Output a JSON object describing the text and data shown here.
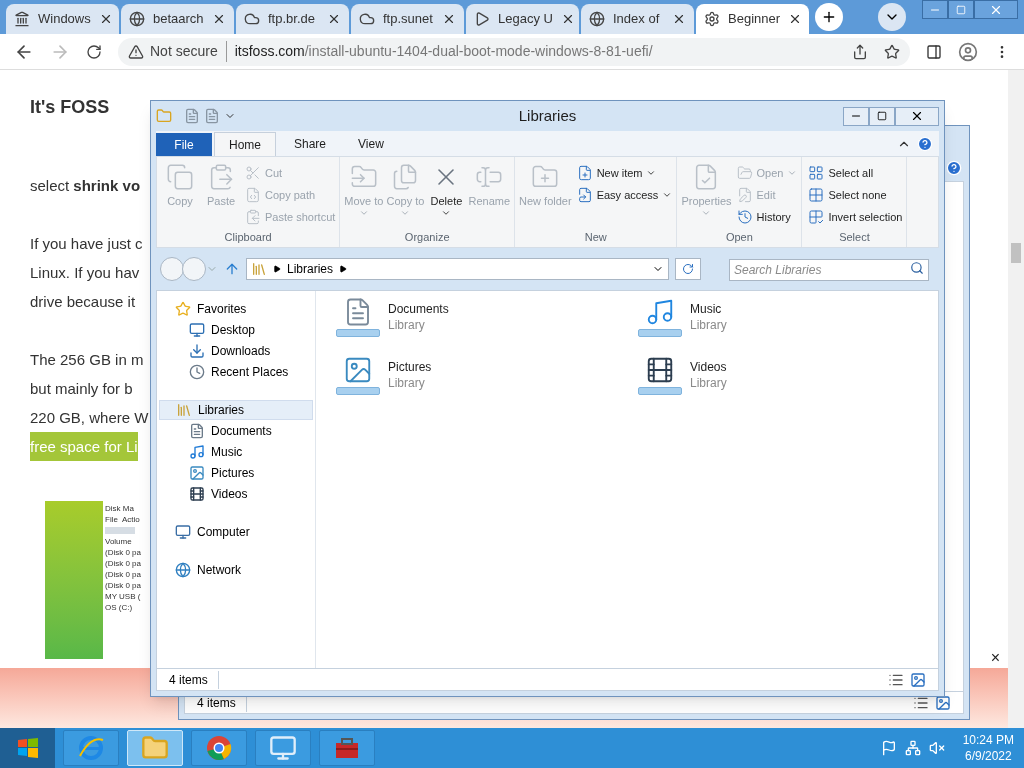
{
  "browser": {
    "tabs": [
      {
        "title": "Windows",
        "selected": false
      },
      {
        "title": "betaarch",
        "selected": false
      },
      {
        "title": "ftp.br.de",
        "selected": false
      },
      {
        "title": "ftp.sunet",
        "selected": false
      },
      {
        "title": "Legacy U",
        "selected": false
      },
      {
        "title": "Index of",
        "selected": false
      },
      {
        "title": "Beginner",
        "selected": true
      }
    ],
    "address": {
      "warning": "Not secure",
      "url": "itsfoss.com/install-ubuntu-1404-dual-boot-mode-windows-8-81-uefi/"
    }
  },
  "page": {
    "site_title": "It's FOSS",
    "paragraphs": [
      {
        "lines": [
          {
            "text": "select **shrink vo**",
            "highlighted": false
          }
        ]
      },
      {
        "lines": [
          {
            "text": "If you have just c",
            "highlighted": false
          },
          {
            "text": "Linux. If you hav",
            "highlighted": false
          },
          {
            "text": "drive because it",
            "highlighted": false
          }
        ]
      },
      {
        "lines": [
          {
            "text": "The 256 GB in m",
            "highlighted": false
          },
          {
            "text": "but mainly for b",
            "highlighted": false
          },
          {
            "text": "220 GB, where W",
            "highlighted": false
          },
          {
            "text": "free space for Li",
            "highlighted": true
          }
        ]
      }
    ],
    "embedded_screenshot": {
      "title": "Disk Ma",
      "menu": [
        "File",
        "Actio"
      ],
      "column": "Volume",
      "rows": [
        "(Disk 0 pa",
        "(Disk 0 pa",
        "(Disk 0 pa",
        "(Disk 0 pa",
        "MY USB (",
        "OS (C:)"
      ]
    },
    "ad": {
      "close": "×"
    }
  },
  "explorer": {
    "title": "Libraries",
    "ribbon_tabs": [
      {
        "label": "File",
        "kind": "file",
        "selected": false
      },
      {
        "label": "Home",
        "kind": "tab",
        "selected": true
      },
      {
        "label": "Share",
        "kind": "tab",
        "selected": false
      },
      {
        "label": "View",
        "kind": "tab",
        "selected": false
      }
    ],
    "groups": [
      {
        "label": "Clipboard",
        "items": [
          {
            "label": "Copy",
            "kind": "large",
            "disabled": true,
            "dropdown": false
          },
          {
            "label": "Paste",
            "kind": "large",
            "disabled": true,
            "dropdown": false
          },
          {
            "label": "Cut",
            "kind": "small",
            "disabled": true,
            "dropdown": false
          },
          {
            "label": "Copy path",
            "kind": "small",
            "disabled": true,
            "dropdown": false
          },
          {
            "label": "Paste shortcut",
            "kind": "small",
            "disabled": true,
            "dropdown": false
          }
        ]
      },
      {
        "label": "Organize",
        "items": [
          {
            "label": "Move to",
            "kind": "large",
            "disabled": true,
            "dropdown": true
          },
          {
            "label": "Copy to",
            "kind": "large",
            "disabled": true,
            "dropdown": true
          },
          {
            "label": "Delete",
            "kind": "large",
            "disabled": false,
            "dropdown": true
          },
          {
            "label": "Rename",
            "kind": "large",
            "disabled": true,
            "dropdown": false
          }
        ]
      },
      {
        "label": "New",
        "items": [
          {
            "label": "New folder",
            "kind": "large",
            "disabled": true,
            "dropdown": false
          },
          {
            "label": "New item",
            "kind": "small",
            "disabled": false,
            "dropdown": true
          },
          {
            "label": "Easy access",
            "kind": "small",
            "disabled": false,
            "dropdown": true
          }
        ]
      },
      {
        "label": "Open",
        "items": [
          {
            "label": "Properties",
            "kind": "large",
            "disabled": true,
            "dropdown": true
          },
          {
            "label": "Open",
            "kind": "small",
            "disabled": true,
            "dropdown": true
          },
          {
            "label": "Edit",
            "kind": "small",
            "disabled": true,
            "dropdown": false
          },
          {
            "label": "History",
            "kind": "small",
            "disabled": false,
            "dropdown": false
          }
        ]
      },
      {
        "label": "Select",
        "items": [
          {
            "label": "Select all",
            "kind": "small",
            "disabled": false,
            "dropdown": false
          },
          {
            "label": "Select none",
            "kind": "small",
            "disabled": false,
            "dropdown": false
          },
          {
            "label": "Invert selection",
            "kind": "small",
            "disabled": false,
            "dropdown": false
          }
        ]
      }
    ],
    "address": {
      "crumbs": [
        "Libraries"
      ],
      "search_placeholder": "Search Libraries"
    },
    "nav": [
      {
        "label": "Favorites",
        "selected": false,
        "children": [
          {
            "label": "Desktop",
            "selected": false
          },
          {
            "label": "Downloads",
            "selected": false
          },
          {
            "label": "Recent Places",
            "selected": false
          }
        ]
      },
      {
        "label": "Libraries",
        "selected": true,
        "children": [
          {
            "label": "Documents",
            "selected": false
          },
          {
            "label": "Music",
            "selected": false
          },
          {
            "label": "Pictures",
            "selected": false
          },
          {
            "label": "Videos",
            "selected": false
          }
        ]
      },
      {
        "label": "Computer",
        "selected": false
      },
      {
        "label": "Network",
        "selected": false
      }
    ],
    "items": [
      {
        "name": "Documents",
        "type": "Library"
      },
      {
        "name": "Music",
        "type": "Library"
      },
      {
        "name": "Pictures",
        "type": "Library"
      },
      {
        "name": "Videos",
        "type": "Library"
      }
    ],
    "status": "4 items"
  },
  "back_window": {
    "status": "4 items"
  },
  "taskbar": {
    "apps": [
      {
        "selected": false
      },
      {
        "selected": true
      },
      {
        "selected": false
      },
      {
        "selected": false
      },
      {
        "selected": false
      }
    ],
    "clock": {
      "time": "10:24 PM",
      "date": "6/9/2022"
    }
  }
}
